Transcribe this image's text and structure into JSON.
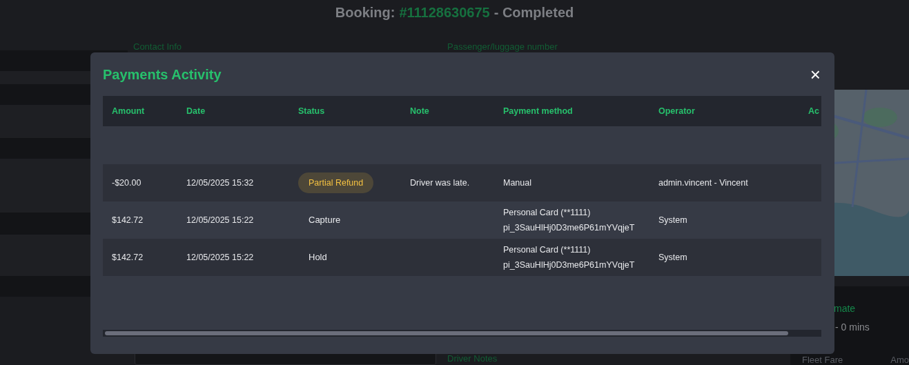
{
  "page": {
    "title": {
      "label": "Booking:",
      "number": "#11128630675",
      "suffix": "- Completed"
    },
    "contact_label": "Contact Info",
    "passenger_label": "Passenger/luggage number",
    "driver_notes_label": "Driver Notes",
    "estimate_label": "mate",
    "estimate_value": "- 0 mins",
    "fleet_fare_label": "Fleet Fare",
    "amount_label": "Amo"
  },
  "modal": {
    "title": "Payments Activity",
    "close": "×",
    "columns": [
      "Amount",
      "Date",
      "Status",
      "Note",
      "Payment method",
      "Operator",
      "Ac"
    ],
    "rows": [
      {
        "amount": "-$20.00",
        "date": "12/05/2025 15:32",
        "status": {
          "text": "Partial Refund",
          "kind": "badge"
        },
        "note": "Driver was late.",
        "payment_method": "Manual",
        "operator": "admin.vincent - Vincent"
      },
      {
        "amount": "$142.72",
        "date": "12/05/2025 15:22",
        "status": {
          "text": "Capture",
          "kind": "plain"
        },
        "payment_method": "Personal Card (**1111)",
        "payment_reference": "pi_3SauHlHj0D3me6P61mYVqjeT",
        "operator": "System"
      },
      {
        "amount": "$142.72",
        "date": "12/05/2025 15:22",
        "status": {
          "text": "Hold",
          "kind": "plain"
        },
        "payment_method": "Personal Card (**1111)",
        "payment_reference": "pi_3SauHlHj0D3me6P61mYVqjeT",
        "operator": "System"
      }
    ]
  }
}
